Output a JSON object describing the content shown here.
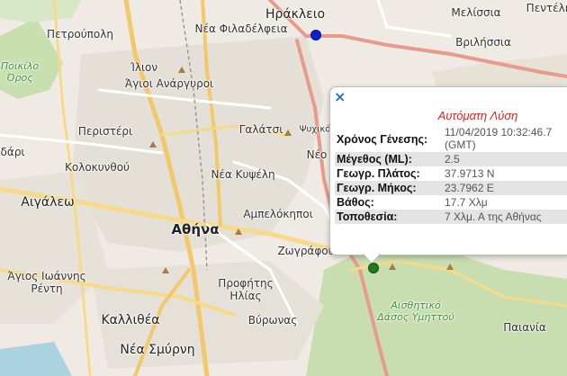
{
  "map": {
    "labels": [
      {
        "id": "irakleio",
        "text": "Ηράκλειο",
        "cls": "big"
      },
      {
        "id": "melissia",
        "text": "Μελίσσια",
        "cls": ""
      },
      {
        "id": "penteli",
        "text": "Πεντέλη",
        "cls": ""
      },
      {
        "id": "petroupoli",
        "text": "Πετρούπολη",
        "cls": ""
      },
      {
        "id": "nea-filadelfeia",
        "text": "Νέα Φιλαδέλφεια",
        "cls": ""
      },
      {
        "id": "vrilissia",
        "text": "Βριλήσσια",
        "cls": ""
      },
      {
        "id": "poikilo-oros",
        "text": "Ποικίλο\nΌρος",
        "cls": "green"
      },
      {
        "id": "ilion",
        "text": "Ίλιον",
        "cls": ""
      },
      {
        "id": "agioi-anargyroi",
        "text": "Άγιοι Ανάργυροι",
        "cls": ""
      },
      {
        "id": "peristeri",
        "text": "Περιστέρι",
        "cls": ""
      },
      {
        "id": "galatsi",
        "text": "Γαλάτσι",
        "cls": ""
      },
      {
        "id": "psychiko",
        "text": "Ψυχικό",
        "cls": "sm"
      },
      {
        "id": "idari",
        "text": "ϊδάρι",
        "cls": ""
      },
      {
        "id": "kolokynthou",
        "text": "Κολοκυνθού",
        "cls": ""
      },
      {
        "id": "neo",
        "text": "Νέο",
        "cls": ""
      },
      {
        "id": "nea-kypseli",
        "text": "Νέα Κυψέλη",
        "cls": ""
      },
      {
        "id": "aigaleo",
        "text": "Αιγάλεω",
        "cls": "big"
      },
      {
        "id": "ampelokipoi",
        "text": "Αμπελόκηποι",
        "cls": ""
      },
      {
        "id": "athina",
        "text": "Αθήνα",
        "cls": "city"
      },
      {
        "id": "zografou",
        "text": "Ζωγράφου",
        "cls": ""
      },
      {
        "id": "agios-ioannis",
        "text": "Άγιος Ιωάννης\nΡέντη",
        "cls": ""
      },
      {
        "id": "profitis-ilias",
        "text": "Προφήτης\nΗλίας",
        "cls": ""
      },
      {
        "id": "kallithea",
        "text": "Καλλιθέα",
        "cls": "big"
      },
      {
        "id": "vyronas",
        "text": "Βύρωνας",
        "cls": ""
      },
      {
        "id": "aisthitiko",
        "text": "Αισθητικό\nΔάσος Υμηττού",
        "cls": "green"
      },
      {
        "id": "paiania",
        "text": "Παιανία",
        "cls": ""
      },
      {
        "id": "nea-smyrni",
        "text": "Νέα Σμύρνη",
        "cls": "big"
      }
    ],
    "markers": [
      {
        "id": "blue-marker",
        "color": "#1020d0"
      },
      {
        "id": "green-marker",
        "color": "#1d7a1d"
      }
    ]
  },
  "popup": {
    "close_symbol": "×",
    "title": "Αυτόματη Λύση",
    "rows": [
      {
        "key": "Χρόνος Γένεσης:",
        "value": "11/04/2019 10:32:46.7\n(GMT)"
      },
      {
        "key": "Μέγεθος (ML):",
        "value": "2.5"
      },
      {
        "key": "Γεωγρ. Πλάτος:",
        "value": "37.9713 N"
      },
      {
        "key": "Γεωγρ. Μήκος:",
        "value": "23.7962 E"
      },
      {
        "key": "Βάθος:",
        "value": "17.7 Χλμ"
      },
      {
        "key": "Τοποθεσία:",
        "value": "7 Χλμ. Α της Αθήνας"
      }
    ]
  },
  "colors": {
    "popup_title": "#d9231f",
    "close": "#2a6fc9"
  }
}
